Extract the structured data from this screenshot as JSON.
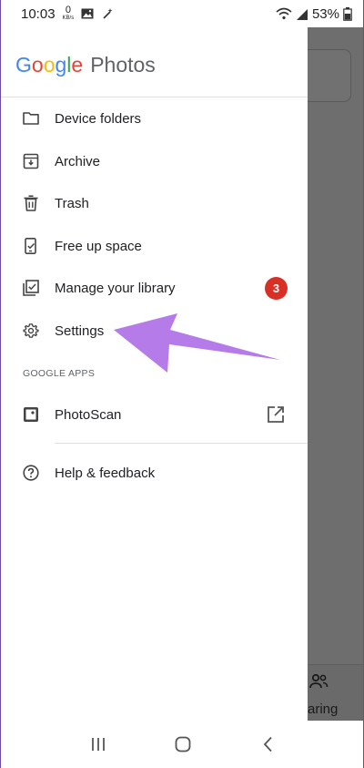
{
  "status_bar": {
    "time": "10:03",
    "net_speed_value": "0",
    "net_speed_unit": "KB/s",
    "battery": "53%",
    "icons": [
      "image-icon",
      "magic-wand-icon",
      "wifi-icon",
      "signal-icon",
      "battery-icon"
    ]
  },
  "drawer": {
    "logo_letters": [
      "G",
      "o",
      "o",
      "g",
      "l",
      "e"
    ],
    "logo_colors": [
      "#4285F4",
      "#EA4335",
      "#FBBC05",
      "#4285F4",
      "#34A853",
      "#EA4335"
    ],
    "logo_product": "Photos",
    "items": [
      {
        "label": "Device folders",
        "icon": "folder-icon"
      },
      {
        "label": "Archive",
        "icon": "archive-icon"
      },
      {
        "label": "Trash",
        "icon": "trash-icon"
      },
      {
        "label": "Free up space",
        "icon": "phone-check-icon"
      },
      {
        "label": "Manage your library",
        "icon": "library-check-icon",
        "badge": "3"
      },
      {
        "label": "Settings",
        "icon": "gear-icon"
      }
    ],
    "section_label": "GOOGLE APPS",
    "apps": [
      {
        "label": "PhotoScan",
        "icon": "photoscan-icon",
        "trailing_icon": "open-external-icon"
      }
    ],
    "footer_items": [
      {
        "label": "Help & feedback",
        "icon": "help-icon"
      }
    ],
    "badge_color": "#D93025"
  },
  "background_app": {
    "bottom_tab_label_partial": "aring"
  },
  "annotation": {
    "arrow_color": "#B57BE8"
  },
  "nav_bar": {
    "buttons": [
      "recents-button",
      "home-button",
      "back-button"
    ]
  }
}
